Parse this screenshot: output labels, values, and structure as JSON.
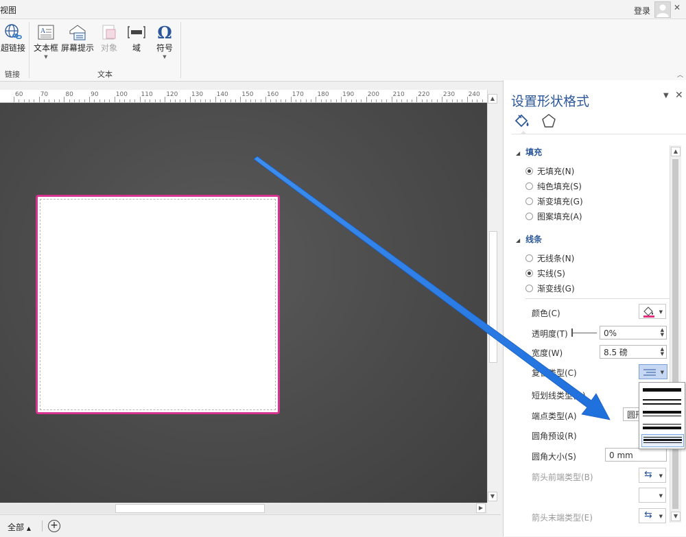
{
  "topbar": {
    "tab_view": "视图",
    "login": "登录"
  },
  "ribbon": {
    "buttons": [
      {
        "label": "超链接",
        "icon": "hyperlink-icon"
      },
      {
        "label": "文本框",
        "icon": "textbox-icon"
      },
      {
        "label": "屏幕提示",
        "icon": "screentip-icon"
      },
      {
        "label": "对象",
        "icon": "object-icon"
      },
      {
        "label": "域",
        "icon": "field-icon"
      },
      {
        "label": "符号",
        "icon": "omega-icon"
      }
    ],
    "groups": {
      "links": "链接",
      "text": "文本"
    }
  },
  "ruler": {
    "labels": [
      "60",
      "70",
      "80",
      "90",
      "100",
      "110",
      "120",
      "130",
      "140",
      "150",
      "160",
      "170",
      "180",
      "190",
      "200",
      "210",
      "220",
      "230",
      "240"
    ]
  },
  "status": {
    "all_pages": "全部"
  },
  "pane": {
    "title": "设置形状格式",
    "fill": {
      "heading": "填充",
      "options": [
        "无填充(N)",
        "纯色填充(S)",
        "渐变填充(G)",
        "图案填充(A)"
      ],
      "selected": 0
    },
    "line": {
      "heading": "线条",
      "options": [
        "无线条(N)",
        "实线(S)",
        "渐变线(G)"
      ],
      "selected": 1
    },
    "props": {
      "color": "颜色(C)",
      "transparency": "透明度(T)",
      "transparency_value": "0%",
      "width": "宽度(W)",
      "width_value": "8.5 磅",
      "compound_type": "复合类型(C)",
      "dash_type": "短划线类型(D)",
      "cap_type": "端点类型(A)",
      "cap_value": "圆形",
      "round_preset": "圆角预设(R)",
      "round_size": "圆角大小(S)",
      "round_size_value": "0 mm",
      "arrow_begin_type": "箭头前端类型(B)",
      "arrow_end_type": "箭头末端类型(E)"
    },
    "accent_color": "#e0307f"
  },
  "colors": {
    "shape_border": "#d6338f",
    "annotation_arrow": "#2f7fe8",
    "pane_title": "#2b579a"
  }
}
